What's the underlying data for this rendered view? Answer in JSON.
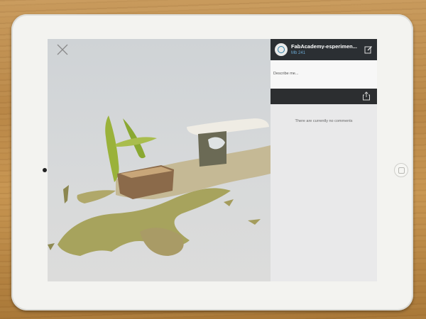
{
  "viewer": {
    "close_icon": "close-icon",
    "content": "3D scan preview"
  },
  "panel": {
    "title": "FabAcademy-esperimen...",
    "size": "Mb 241",
    "avatar_icon": "profile-avatar",
    "edit_icon": "compose-icon",
    "description_placeholder": "Describe me...",
    "share_icon": "share-icon",
    "comments_empty": "There are currently no comments"
  },
  "colors": {
    "header": "#2b2f33",
    "accent": "#6aa7d0",
    "panel_bg": "#e9e9ea"
  }
}
